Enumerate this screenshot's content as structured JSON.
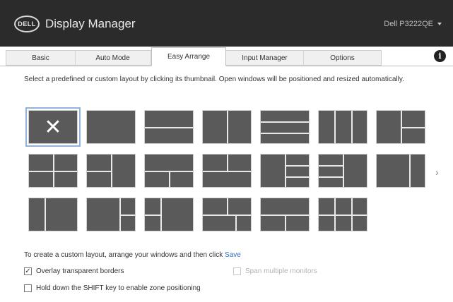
{
  "header": {
    "logo_text": "DELL",
    "title": "Display Manager",
    "monitor": "Dell P3222QE"
  },
  "tabs": [
    {
      "label": "Basic"
    },
    {
      "label": "Auto Mode"
    },
    {
      "label": "Easy Arrange"
    },
    {
      "label": "Input Manager"
    },
    {
      "label": "Options"
    }
  ],
  "active_tab": "Easy Arrange",
  "description": "Select a predefined or custom layout by clicking its thumbnail. Open windows will be positioned and resized automatically.",
  "layouts_count": 20,
  "selected_layout": 1,
  "footer": {
    "custom_text": "To create a custom layout, arrange your windows and then click",
    "save_link": "Save",
    "option_transparent": "Overlay transparent borders",
    "option_multiple_monitors": "Span multiple monitors",
    "option_shift": "Hold down the SHIFT key to enable zone positioning"
  },
  "checkboxes": {
    "transparent": true,
    "multiple_monitors": false,
    "shift": false
  },
  "colors": {
    "header_bg": "#2b2b2b",
    "tile_bg": "#5a5a5a",
    "link": "#2f6fbf",
    "selection": "#8fb3d9"
  },
  "icons": {
    "info": "info-icon",
    "close": "close-icon",
    "next": "chevron-right-icon",
    "dropdown": "chevron-down-icon"
  }
}
